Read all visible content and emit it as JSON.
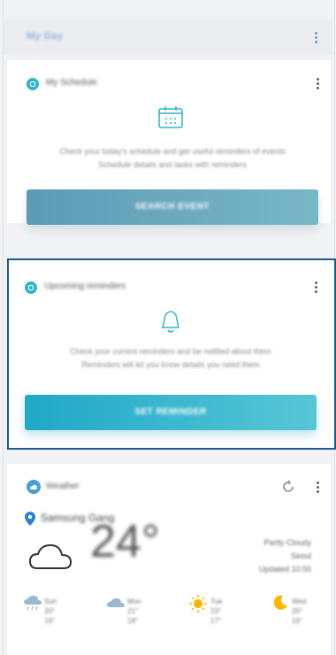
{
  "header": {
    "title": "My Day"
  },
  "cards": [
    {
      "title": "My Schedule",
      "description_line1": "Check your today's schedule and get useful reminders of events",
      "description_line2": "Schedule details and tasks with reminders",
      "button_label": "SEARCH EVENT",
      "icon": "calendar-icon"
    },
    {
      "title": "Upcoming reminders",
      "description_line1": "Check your current reminders and be notified about them",
      "description_line2": "Reminders will let you know details you need them",
      "button_label": "SET REMINDER",
      "icon": "bell-icon"
    },
    {
      "title": "Weather",
      "location": "Samsung Gang",
      "temperature": "24°",
      "info_line1": "Partly Cloudy",
      "info_line2": "Seoul",
      "info_line3": "Updated 10:00",
      "forecast": [
        {
          "icon": "rain-cloud-icon",
          "line1": "Sun",
          "line2": "20°",
          "line3": "19°"
        },
        {
          "icon": "cloud-icon",
          "line1": "Mon",
          "line2": "21°",
          "line3": "18°"
        },
        {
          "icon": "sun-icon",
          "line1": "Tue",
          "line2": "23°",
          "line3": "17°"
        },
        {
          "icon": "moon-icon",
          "line1": "Wed",
          "line2": "20°",
          "line3": "16°"
        }
      ]
    }
  ],
  "colors": {
    "accent": "#2fb4c8",
    "highlight_border": "#1b5a8f",
    "button_primary": "#20a8c7",
    "button_muted": "#6aa8be"
  }
}
